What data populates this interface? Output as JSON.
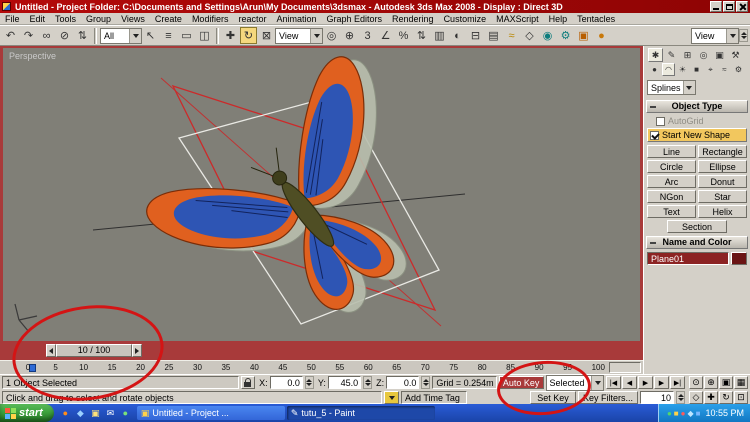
{
  "colors": {
    "titlebar_red": "#b40a0a",
    "autokey_red": "#a83a3a",
    "annotation_red": "#d41414",
    "viewport_gray": "#807f77",
    "taskbar_blue": "#2a5cd6",
    "tray_blue": "#2aa0ea",
    "start_green": "#3da23d",
    "object_color": "#8c2323"
  },
  "titlebar": {
    "title": "Untitled    - Project Folder: C:\\Documents and Settings\\Arun\\My Documents\\3dsmax    - Autodesk 3ds Max 2008   - Display : Direct 3D"
  },
  "menubar": {
    "items": [
      "File",
      "Edit",
      "Tools",
      "Group",
      "Views",
      "Create",
      "Modifiers",
      "reactor",
      "Animation",
      "Graph Editors",
      "Rendering",
      "Customize",
      "MAXScript",
      "Help",
      "Tentacles"
    ]
  },
  "toolbar": {
    "icons_a": [
      {
        "name": "undo-icon",
        "glyph": "↶"
      },
      {
        "name": "redo-icon",
        "glyph": "↷"
      },
      {
        "name": "select-link-icon",
        "glyph": "∞"
      },
      {
        "name": "unlink-icon",
        "glyph": "⊘"
      },
      {
        "name": "bind-spacewarp-icon",
        "glyph": "⇅"
      }
    ],
    "filter_dropdown": "All",
    "icons_b": [
      {
        "name": "select-object-icon",
        "glyph": "↖"
      },
      {
        "name": "select-by-name-icon",
        "glyph": "≡"
      },
      {
        "name": "rectangular-region-icon",
        "glyph": "▭"
      },
      {
        "name": "window-crossing-icon",
        "glyph": "◫"
      }
    ],
    "icons_c": [
      {
        "name": "select-move-icon",
        "glyph": "✚"
      },
      {
        "name": "select-rotate-icon",
        "glyph": "↻",
        "active": true
      },
      {
        "name": "select-scale-icon",
        "glyph": "⊠"
      }
    ],
    "coord_dropdown": "View",
    "icons_d": [
      {
        "name": "use-pivot-center-icon",
        "glyph": "◎"
      },
      {
        "name": "select-manipulate-icon",
        "glyph": "⊕"
      },
      {
        "name": "snap-toggle-icon",
        "glyph": "3"
      },
      {
        "name": "angle-snap-icon",
        "glyph": "∠"
      },
      {
        "name": "percent-snap-icon",
        "glyph": "%"
      },
      {
        "name": "spinner-snap-icon",
        "glyph": "⇅"
      },
      {
        "name": "named-selection-sets-icon",
        "glyph": "▥"
      },
      {
        "name": "mirror-icon",
        "glyph": "◐"
      },
      {
        "name": "align-icon",
        "glyph": "⊟"
      },
      {
        "name": "layer-manager-icon",
        "glyph": "▤"
      },
      {
        "name": "curve-editor-icon",
        "glyph": "≈",
        "tint": "#b88600"
      },
      {
        "name": "schematic-view-icon",
        "glyph": "◇"
      },
      {
        "name": "material-editor-icon",
        "glyph": "◉",
        "tint": "#0e7d7d"
      },
      {
        "name": "render-setup-icon",
        "glyph": "⚙",
        "tint": "#0e7d7d"
      },
      {
        "name": "render-frame-icon",
        "glyph": "▣",
        "tint": "#b85e00"
      },
      {
        "name": "quick-render-icon",
        "glyph": "●",
        "tint": "#c8780a"
      }
    ],
    "view_dropdown": "View"
  },
  "viewport": {
    "label": "Perspective"
  },
  "command_panel": {
    "tabs": [
      {
        "name": "create-tab-icon",
        "glyph": "✱",
        "active": true
      },
      {
        "name": "modify-tab-icon",
        "glyph": "✎"
      },
      {
        "name": "hierarchy-tab-icon",
        "glyph": "⊞"
      },
      {
        "name": "motion-tab-icon",
        "glyph": "◎"
      },
      {
        "name": "display-tab-icon",
        "glyph": "▣"
      },
      {
        "name": "utilities-tab-icon",
        "glyph": "⚒"
      }
    ],
    "categories": [
      {
        "name": "geometry-category-icon",
        "glyph": "●"
      },
      {
        "name": "shapes-category-icon",
        "glyph": "◠",
        "active": true
      },
      {
        "name": "lights-category-icon",
        "glyph": "☀"
      },
      {
        "name": "cameras-category-icon",
        "glyph": "■"
      },
      {
        "name": "helpers-category-icon",
        "glyph": "⌖"
      },
      {
        "name": "spacewarps-category-icon",
        "glyph": "≈"
      },
      {
        "name": "systems-category-icon",
        "glyph": "⚙"
      }
    ],
    "subcategory_dropdown": "Splines",
    "object_type_header": "Object Type",
    "autogrid_label": "AutoGrid",
    "start_new_shape_label": "Start New Shape",
    "shape_buttons": [
      {
        "name": "line-button",
        "label": "Line"
      },
      {
        "name": "rectangle-button",
        "label": "Rectangle"
      },
      {
        "name": "circle-button",
        "label": "Circle"
      },
      {
        "name": "ellipse-button",
        "label": "Ellipse"
      },
      {
        "name": "arc-button",
        "label": "Arc"
      },
      {
        "name": "donut-button",
        "label": "Donut"
      },
      {
        "name": "ngon-button",
        "label": "NGon"
      },
      {
        "name": "star-button",
        "label": "Star"
      },
      {
        "name": "text-button",
        "label": "Text"
      },
      {
        "name": "helix-button",
        "label": "Helix"
      },
      {
        "name": "section-button",
        "label": "Section"
      }
    ],
    "name_color_header": "Name and Color",
    "object_name": "Plane01"
  },
  "timeslider": {
    "thumb_label": "10 / 100"
  },
  "trackbar": {
    "ticks": [
      "0",
      "5",
      "10",
      "15",
      "20",
      "25",
      "30",
      "35",
      "40",
      "45",
      "50",
      "55",
      "60",
      "65",
      "70",
      "75",
      "80",
      "85",
      "90",
      "95",
      "100"
    ]
  },
  "status": {
    "selection_status": "1 Object Selected",
    "prompt": "Click and drag to select and rotate objects",
    "x_label": "X:",
    "x_value": "0.0",
    "y_label": "Y:",
    "y_value": "45.0",
    "z_label": "Z:",
    "z_value": "0.0",
    "grid_label": "Grid = 0.254m",
    "add_time_tag": "Add Time Tag",
    "auto_key_label": "Auto Key",
    "set_key_label": "Set Key",
    "key_mode_dropdown": "Selected",
    "key_filters_label": "Key Filters...",
    "frame_value": "10",
    "playback": [
      {
        "name": "go-to-start-button",
        "glyph": "|◀"
      },
      {
        "name": "previous-frame-button",
        "glyph": "◀"
      },
      {
        "name": "play-button",
        "glyph": "▶"
      },
      {
        "name": "next-frame-button",
        "glyph": "▶"
      },
      {
        "name": "go-to-end-button",
        "glyph": "▶|"
      }
    ],
    "nav_row1": [
      {
        "name": "zoom-icon",
        "glyph": "⊙"
      },
      {
        "name": "zoom-all-icon",
        "glyph": "⊕"
      },
      {
        "name": "zoom-extents-icon",
        "glyph": "▣"
      },
      {
        "name": "zoom-extents-all-icon",
        "glyph": "▦"
      }
    ],
    "nav_row2": [
      {
        "name": "field-of-view-icon",
        "glyph": "◇"
      },
      {
        "name": "pan-icon",
        "glyph": "✚"
      },
      {
        "name": "arc-rotate-icon",
        "glyph": "↻"
      },
      {
        "name": "maximize-viewport-icon",
        "glyph": "⊡"
      }
    ]
  },
  "taskbar": {
    "start_label": "start",
    "quick_launch": [
      {
        "name": "quick-launch-icon-1",
        "glyph": "●",
        "tint": "#ff8c1a"
      },
      {
        "name": "quick-launch-icon-2",
        "glyph": "◆",
        "tint": "#9ad0ff"
      },
      {
        "name": "quick-launch-icon-3",
        "glyph": "▣",
        "tint": "#ffe27a"
      },
      {
        "name": "quick-launch-icon-4",
        "glyph": "✉",
        "tint": "#ffffff"
      },
      {
        "name": "quick-launch-icon-5",
        "glyph": "●",
        "tint": "#7ae07a"
      }
    ],
    "tasks": [
      {
        "name": "task-3dsmax",
        "icon": "▣",
        "label": "Untitled      - Project ..."
      },
      {
        "name": "task-paint",
        "icon": "✎",
        "label": "tutu_5 - Paint",
        "active": true
      }
    ],
    "tray_icons": [
      {
        "name": "tray-icon-1",
        "glyph": "●",
        "tint": "#53d769"
      },
      {
        "name": "tray-icon-2",
        "glyph": "■",
        "tint": "#ffd24a"
      },
      {
        "name": "tray-icon-3",
        "glyph": "●",
        "tint": "#ff5a5a"
      },
      {
        "name": "tray-icon-4",
        "glyph": "◆",
        "tint": "#bfe6ff"
      },
      {
        "name": "tray-icon-5",
        "glyph": "■",
        "tint": "#7ab8ff"
      }
    ],
    "clock": "10:55 PM"
  }
}
